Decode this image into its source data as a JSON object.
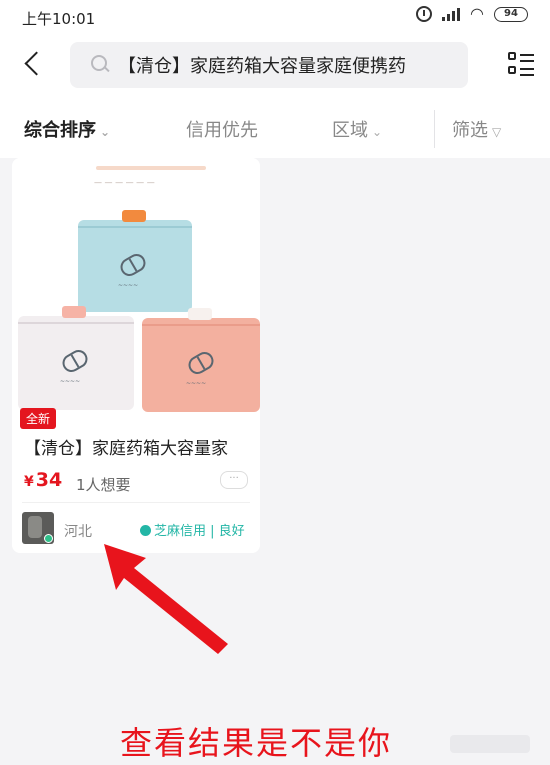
{
  "status_bar": {
    "time": "上午10:01",
    "battery": "94",
    "icons": [
      "alarm-icon",
      "signal-icon",
      "wifi-icon",
      "battery-icon"
    ]
  },
  "header": {
    "search_query": "【清仓】家庭药箱大容量家庭便携药",
    "icons": [
      "back-arrow-icon",
      "search-icon",
      "grid-view-icon"
    ]
  },
  "filters": {
    "sort": "综合排序",
    "credit": "信用优先",
    "region": "区域",
    "screen": "筛选"
  },
  "product": {
    "badge": "全新",
    "title": "【清仓】家庭药箱大容量家",
    "currency": "¥",
    "price": "34",
    "wants": "1人想要",
    "location": "河北",
    "credit": "芝麻信用 | 良好",
    "box_colors": [
      "#b6dde4",
      "#f2eef0",
      "#f3b09f"
    ],
    "accent": "#e4161f"
  },
  "annotation": {
    "caption": "查看结果是不是你",
    "color": "#e8141c"
  }
}
